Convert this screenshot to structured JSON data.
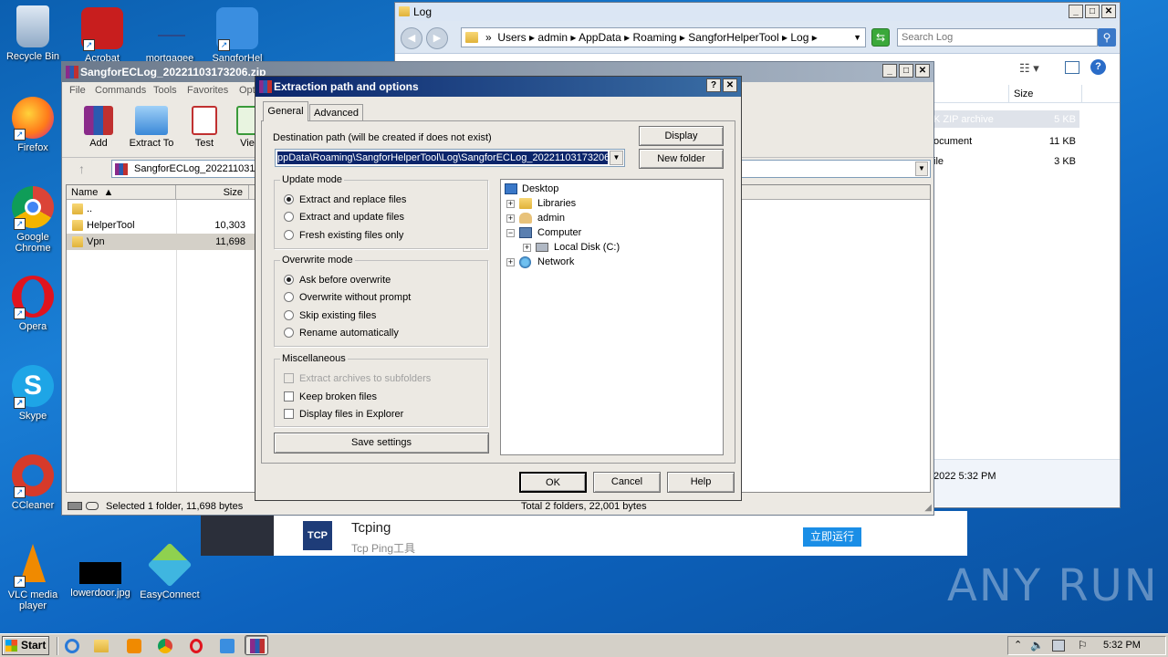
{
  "desktop": {
    "icons": [
      {
        "label": "Recycle Bin",
        "icon": "recycle-bin-icon",
        "color": "#9ab6d4"
      },
      {
        "label": "Acrobat",
        "icon": "acrobat-icon",
        "color": "#c81e1e"
      },
      {
        "label": "mortgagee",
        "icon": "file-icon",
        "color": "#2a4a8a"
      },
      {
        "label": "SangforHel",
        "icon": "sangfor-icon",
        "color": "#3a8ee0"
      },
      {
        "label": "Firefox",
        "icon": "firefox-icon",
        "color": "#ff7a1a"
      },
      {
        "label": "Google Chrome",
        "icon": "chrome-icon",
        "color": "#4caf50"
      },
      {
        "label": "Opera",
        "icon": "opera-icon",
        "color": "#e0141e"
      },
      {
        "label": "Skype",
        "icon": "skype-icon",
        "color": "#1ea5e6"
      },
      {
        "label": "CCleaner",
        "icon": "ccleaner-icon",
        "color": "#d63a2a"
      },
      {
        "label": "VLC media player",
        "icon": "vlc-icon",
        "color": "#f08a00"
      },
      {
        "label": "lowerdoor.jpg",
        "icon": "image-icon",
        "color": "#000000"
      },
      {
        "label": "EasyConnect",
        "icon": "easyconnect-icon",
        "color": "#3fb6e0"
      }
    ]
  },
  "explorer": {
    "title": "Log",
    "breadcrumb": [
      "Users",
      "admin",
      "AppData",
      "Roaming",
      "SangforHelperTool",
      "Log"
    ],
    "search_placeholder": "Search Log",
    "col_size": "Size",
    "rows": [
      {
        "type": "K ZIP archive",
        "size": "5 KB"
      },
      {
        "type": "ocument",
        "size": "11 KB"
      },
      {
        "type": "ile",
        "size": "3 KB"
      }
    ],
    "date": "2022 5:32 PM"
  },
  "winrar": {
    "title": "SangforECLog_20221103173206.zip",
    "menu": [
      "File",
      "Commands",
      "Tools",
      "Favorites",
      "Opti"
    ],
    "toolbar": [
      "Add",
      "Extract To",
      "Test",
      "Vie"
    ],
    "path": "SangforECLog_2022110317",
    "col_name": "Name",
    "col_size": "Size",
    "files": [
      {
        "name": "..",
        "size": ""
      },
      {
        "name": "HelperTool",
        "size": "10,303"
      },
      {
        "name": "Vpn",
        "size": "11,698"
      }
    ],
    "status_left": "Selected 1 folder, 11,698 bytes",
    "status_right": "Total 2 folders, 22,001 bytes"
  },
  "dialog": {
    "title": "Extraction path and options",
    "tabs": [
      "General",
      "Advanced"
    ],
    "dest_label": "Destination path (will be created if does not exist)",
    "dest_value": "ppData\\Roaming\\SangforHelperTool\\Log\\SangforECLog_20221103173206",
    "display_btn": "Display",
    "newfolder_btn": "New folder",
    "update_mode": {
      "label": "Update mode",
      "options": [
        "Extract and replace files",
        "Extract and update files",
        "Fresh existing files only"
      ],
      "selected": 0
    },
    "overwrite_mode": {
      "label": "Overwrite mode",
      "options": [
        "Ask before overwrite",
        "Overwrite without prompt",
        "Skip existing files",
        "Rename automatically"
      ],
      "selected": 0
    },
    "misc": {
      "label": "Miscellaneous",
      "options": [
        "Extract archives to subfolders",
        "Keep broken files",
        "Display files in Explorer"
      ]
    },
    "save_btn": "Save settings",
    "tree": [
      "Desktop",
      "Libraries",
      "admin",
      "Computer",
      "Local Disk (C:)",
      "Network"
    ],
    "ok": "OK",
    "cancel": "Cancel",
    "help": "Help"
  },
  "ad": {
    "logo": "TCP",
    "title": "Tcping",
    "subtitle": "Tcp Ping工具",
    "button": "立即运行"
  },
  "watermark": "ANY RUN",
  "taskbar": {
    "start": "Start",
    "clock": "5:32 PM"
  }
}
